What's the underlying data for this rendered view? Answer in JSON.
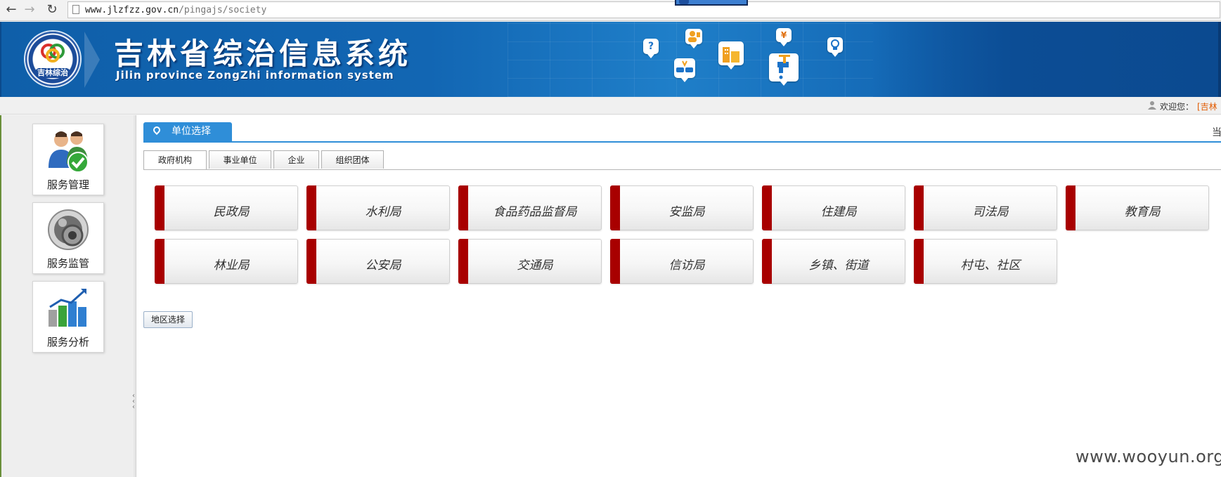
{
  "browser": {
    "url_host": "www.jlzfzz.gov.cn",
    "url_path": "/pingajs/society"
  },
  "banner": {
    "logo_text": "吉林综治",
    "title": "吉林省综治信息系统",
    "subtitle": "Jilin province ZongZhi information system",
    "icon_question": "?",
    "icon_yuan": "¥"
  },
  "userbar": {
    "welcome_label": "欢迎您：",
    "user": "[吉林"
  },
  "sidebar": {
    "items": [
      {
        "label": "服务管理",
        "icon": "users-check-icon"
      },
      {
        "label": "服务监管",
        "icon": "gear-monitor-icon"
      },
      {
        "label": "服务分析",
        "icon": "bar-chart-icon"
      }
    ]
  },
  "main": {
    "section_title": "单位选择",
    "right_cut": "当",
    "tabs": [
      "政府机构",
      "事业单位",
      "企业",
      "组织团体"
    ],
    "active_tab": 0,
    "departments_row1": [
      "民政局",
      "水利局",
      "食品药品监督局",
      "安监局",
      "住建局",
      "司法局",
      "教育局"
    ],
    "departments_row2": [
      "林业局",
      "公安局",
      "交通局",
      "信访局",
      "乡镇、街道",
      "村屯、社区"
    ],
    "region_button": "地区选择"
  },
  "colors": {
    "banner_blue": "#1266b3",
    "tab_blue": "#2f8ed8",
    "dept_accent": "#a80000",
    "user_orange": "#e25a00"
  },
  "watermark": "www.wooyun.org"
}
